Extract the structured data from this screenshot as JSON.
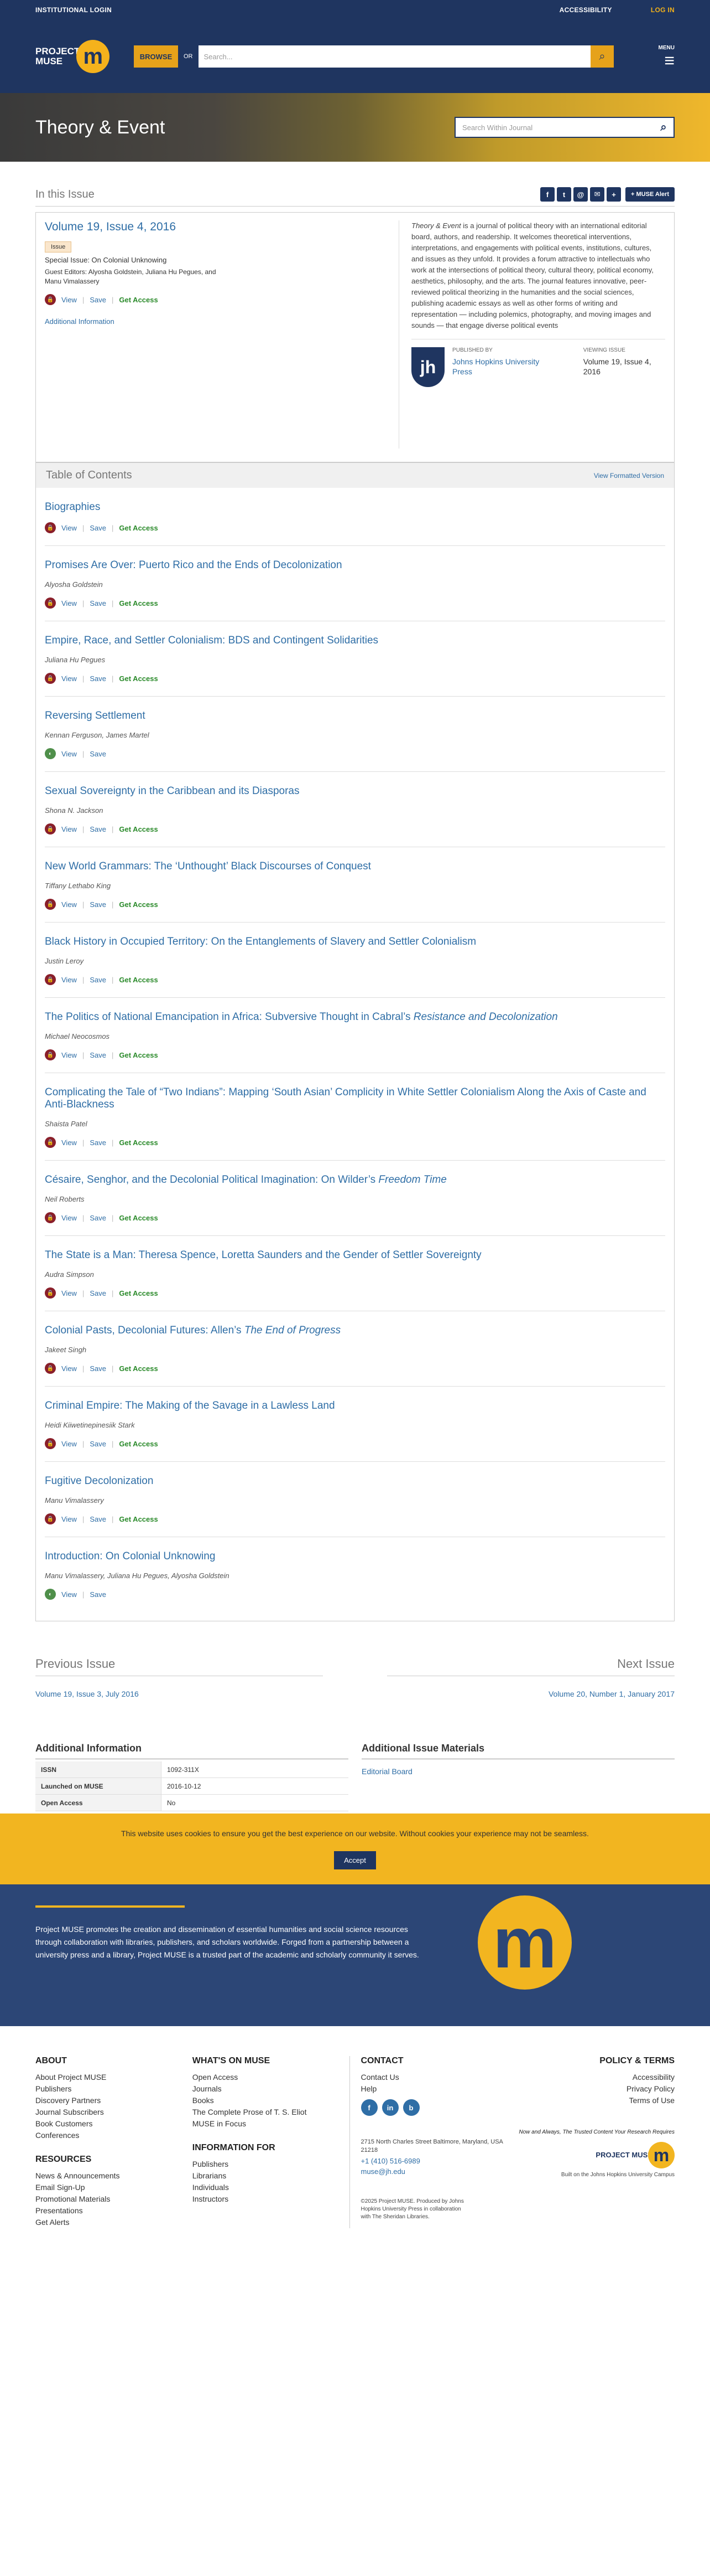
{
  "topbar": {
    "institution": "INSTITUTIONAL LOGIN",
    "accessibility": "ACCESSIBILITY",
    "login": "LOG IN"
  },
  "header": {
    "logo_line1": "PROJECT",
    "logo_line2": "MUSE",
    "logo_mark": "m",
    "browse": "BROWSE",
    "or": "OR",
    "search_placeholder": "Search...",
    "menu": "MENU"
  },
  "journal": {
    "title": "Theory & Event",
    "search_placeholder": "Search Within Journal"
  },
  "in_this_issue": {
    "heading": "In this Issue",
    "share_icons": [
      "f",
      "t",
      "@",
      "✉",
      "+"
    ],
    "alert": "+ MUSE Alert"
  },
  "issue": {
    "title": "Volume 19, Issue 4, 2016",
    "badge": "Issue",
    "special": "Special Issue: On Colonial Unknowing",
    "editors": "Guest Editors: Alyosha Goldstein, Juliana Hu Pegues, and Manu Vimalassery",
    "view": "View",
    "save": "Save",
    "get_access": "Get Access",
    "additional": "Additional Information",
    "description_title": "Theory & Event",
    "description": " is a journal of political theory with an international editorial board, authors, and readership. It welcomes theoretical interventions, interpretations, and engagements with political events, institutions, cultures, and issues as they unfold. It provides a forum attractive to intellectuals who work at the intersections of political theory, cultural theory, political economy, aesthetics, philosophy, and the arts. The journal features innovative, peer-reviewed political theorizing in the humanities and the social sciences, publishing academic essays as well as other forms of writing and representation — including polemics, photography, and moving images and sounds — that engage diverse political events",
    "publisher_label": "PUBLISHED BY",
    "publisher": "Johns Hopkins University Press",
    "viewing_label": "VIEWING ISSUE",
    "viewing": "Volume 19, Issue 4, 2016",
    "jh_mark": "jh"
  },
  "toc": {
    "heading": "Table of Contents",
    "formatted": "View Formatted Version",
    "articles": [
      {
        "title": "Biographies",
        "authors": "",
        "access": "closed",
        "get_access": "Get Access"
      },
      {
        "title": "Promises Are Over: Puerto Rico and the Ends of Decolonization",
        "authors": "Alyosha Goldstein",
        "access": "closed",
        "get_access": "Get Access"
      },
      {
        "title": "Empire, Race, and Settler Colonialism: BDS and Contingent Solidarities",
        "authors": "Juliana Hu Pegues",
        "access": "closed",
        "get_access": "Get Access"
      },
      {
        "title": "Reversing Settlement",
        "authors": "Kennan Ferguson, James Martel",
        "access": "open",
        "get_access": ""
      },
      {
        "title": "Sexual Sovereignty in the Caribbean and its Diasporas",
        "authors": "Shona N. Jackson",
        "access": "closed",
        "get_access": "Get Access"
      },
      {
        "title": "New World Grammars: The ‘Unthought’ Black Discourses of Conquest",
        "authors": "Tiffany Lethabo King",
        "access": "closed",
        "get_access": "Get Access"
      },
      {
        "title": "Black History in Occupied Territory: On the Entanglements of Slavery and Settler Colonialism",
        "authors": "Justin Leroy",
        "access": "closed",
        "get_access": "Get Access"
      },
      {
        "title": "The Politics of National Emancipation in Africa: Subversive Thought in Cabral’s ",
        "title_italic": "Resistance and Decolonization",
        "authors": "Michael Neocosmos",
        "access": "closed",
        "get_access": "Get Access"
      },
      {
        "title": "Complicating the Tale of “Two Indians”: Mapping ‘South Asian’ Complicity in White Settler Colonialism Along the Axis of Caste and Anti-Blackness",
        "authors": "Shaista Patel",
        "access": "closed",
        "get_access": "Get Access"
      },
      {
        "title": "Césaire, Senghor, and the Decolonial Political Imagination: On Wilder’s ",
        "title_italic": "Freedom Time",
        "authors": "Neil Roberts",
        "access": "closed",
        "get_access": "Get Access"
      },
      {
        "title": "The State is a Man: Theresa Spence, Loretta Saunders and the Gender of Settler Sovereignty",
        "authors": "Audra Simpson",
        "access": "closed",
        "get_access": "Get Access"
      },
      {
        "title": "Colonial Pasts, Decolonial Futures: Allen’s ",
        "title_italic": "The End of Progress",
        "authors": "Jakeet Singh",
        "access": "closed",
        "get_access": "Get Access"
      },
      {
        "title": "Criminal Empire: The Making of the Savage in a Lawless Land",
        "authors": "Heidi Kiiwetinepinesiik Stark",
        "access": "closed",
        "get_access": "Get Access"
      },
      {
        "title": "Fugitive Decolonization",
        "authors": "Manu Vimalassery",
        "access": "closed",
        "get_access": "Get Access"
      },
      {
        "title": "Introduction: On Colonial Unknowing",
        "authors": "Manu Vimalassery, Juliana Hu Pegues, Alyosha Goldstein",
        "access": "open",
        "get_access": ""
      }
    ]
  },
  "nav": {
    "prev_heading": "Previous Issue",
    "prev": "Volume 19, Issue 3, July 2016",
    "next_heading": "Next Issue",
    "next": "Volume 20, Number 1, January 2017"
  },
  "additional": {
    "heading": "Additional Information",
    "rows": [
      {
        "k": "ISSN",
        "v": "1092-311X"
      },
      {
        "k": "Launched on MUSE",
        "v": "2016-10-12"
      },
      {
        "k": "Open Access",
        "v": "No"
      }
    ],
    "materials_heading": "Additional Issue Materials",
    "editorial_board": "Editorial Board"
  },
  "cookie": {
    "text": "This website uses cookies to ensure you get the best experience on our website. Without cookies your experience may not be seamless.",
    "accept": "Accept"
  },
  "footer_hero": {
    "about": "Project MUSE promotes the creation and dissemination of essential humanities and social science resources through collaboration with libraries, publishers, and scholars worldwide. Forged from a partnership between a university press and a library, Project MUSE is a trusted part of the academic and scholarly community it serves.",
    "mark": "m"
  },
  "footer": {
    "about": {
      "heading": "ABOUT",
      "links": [
        "About Project MUSE",
        "Publishers",
        "Discovery Partners",
        "Journal Subscribers",
        "Book Customers",
        "Conferences"
      ]
    },
    "resources": {
      "heading": "RESOURCES",
      "links": [
        "News & Announcements",
        "Email Sign-Up",
        "Promotional Materials",
        "Presentations",
        "Get Alerts"
      ]
    },
    "whats_on": {
      "heading": "WHAT'S ON MUSE",
      "links": [
        "Open Access",
        "Journals",
        "Books",
        "The Complete Prose of T. S. Eliot",
        "MUSE in Focus"
      ]
    },
    "info_for": {
      "heading": "INFORMATION FOR",
      "links": [
        "Publishers",
        "Librarians",
        "Individuals",
        "Instructors"
      ]
    },
    "contact": {
      "heading": "CONTACT",
      "links": [
        "Contact Us",
        "Help"
      ],
      "social": [
        "f",
        "in",
        "b"
      ],
      "address": "2715 North Charles Street Baltimore, Maryland, USA 21218",
      "phone": "+1 (410) 516-6989",
      "email": "muse@jh.edu",
      "copyright": "©2025 Project MUSE. Produced by Johns Hopkins University Press in collaboration with The Sheridan Libraries."
    },
    "policy": {
      "heading": "POLICY & TERMS",
      "links": [
        "Accessibility",
        "Privacy Policy",
        "Terms of Use"
      ],
      "tagline": "Now and Always, The Trusted Content Your Research Requires",
      "logo_text": "PROJECT MUSE",
      "campus": "Built on the Johns Hopkins University Campus"
    }
  },
  "colors": {
    "navy": "#1f3560",
    "gold": "#f2b520",
    "link": "#2f6ea6",
    "access_green": "#2a8a2a",
    "lock_red": "#8a1f2a"
  }
}
